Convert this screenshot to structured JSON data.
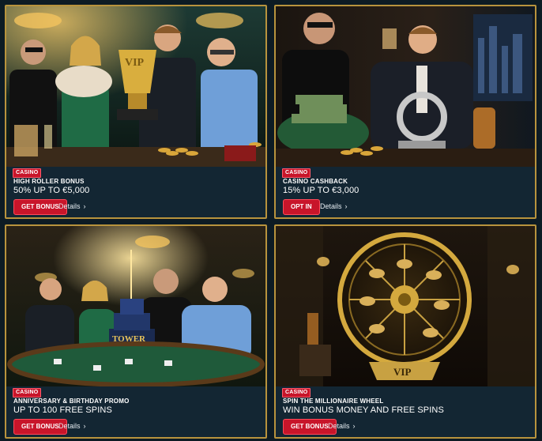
{
  "promotions": [
    {
      "badge": "CASINO",
      "subtitle": "HIGH ROLLER BONUS",
      "title": "50% UP TO €5,000",
      "button_label": "GET BONUS",
      "details_label": "Details",
      "chevron": "›"
    },
    {
      "badge": "CASINO",
      "subtitle": "CASINO CASHBACK",
      "title": "15% UP TO €3,000",
      "button_label": "OPT IN",
      "details_label": "Details",
      "chevron": "›"
    },
    {
      "badge": "CASINO",
      "subtitle": "ANNIVERSARY & BIRTHDAY PROMO",
      "title": "UP TO 100 FREE SPINS",
      "button_label": "GET BONUS",
      "details_label": "Details",
      "chevron": "›",
      "art_text": "TOWER"
    },
    {
      "badge": "CASINO",
      "subtitle": "SPIN THE MILLIONAIRE WHEEL",
      "title": "WIN BONUS MONEY AND FREE SPINS",
      "button_label": "GET BONUS",
      "details_label": "Details",
      "chevron": "›",
      "art_text": "VIP"
    }
  ],
  "colors": {
    "accent_red": "#c8152a",
    "gold_border": "#b8933d",
    "card_bg": "#132633"
  }
}
